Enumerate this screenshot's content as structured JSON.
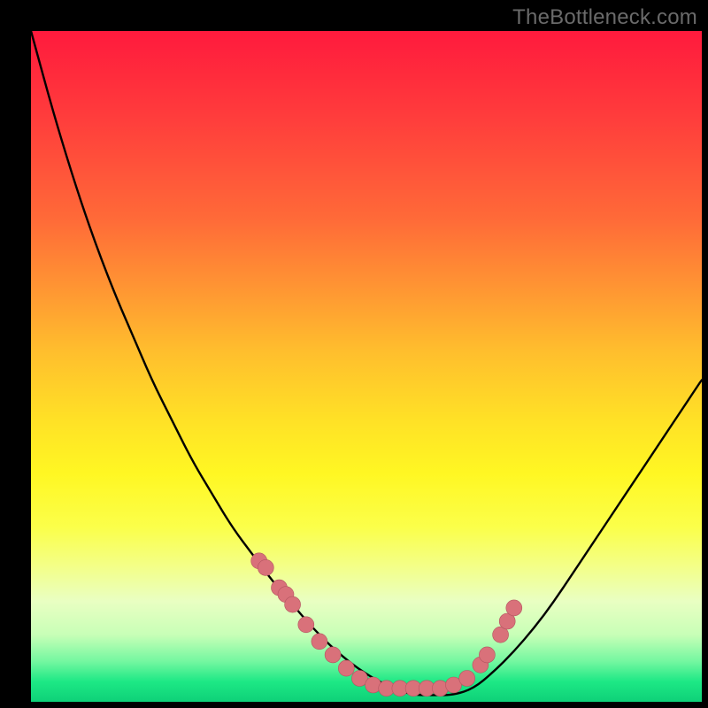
{
  "watermark": "TheBottleneck.com",
  "colors": {
    "dot_fill": "#d9717a",
    "dot_stroke": "#b35560",
    "curve": "#000000"
  },
  "chart_data": {
    "type": "line",
    "title": "",
    "xlabel": "",
    "ylabel": "",
    "xlim": [
      0,
      100
    ],
    "ylim": [
      0,
      100
    ],
    "x": [
      0,
      3,
      6,
      9,
      12,
      15,
      18,
      21,
      24,
      27,
      30,
      33,
      36,
      39,
      42,
      45,
      48,
      51,
      54,
      57,
      60,
      63,
      66,
      69,
      72,
      75,
      78,
      81,
      84,
      87,
      90,
      93,
      96,
      100
    ],
    "values": [
      100,
      89,
      79,
      70,
      62,
      55,
      48,
      42,
      36,
      31,
      26,
      22,
      18,
      14.5,
      11,
      8,
      5.5,
      3.5,
      2,
      1,
      1,
      1,
      2,
      4.5,
      7.5,
      11,
      15,
      19.5,
      24,
      28.5,
      33,
      37.5,
      42,
      48
    ],
    "dots_x": [
      34,
      35,
      37,
      38,
      39,
      41,
      43,
      45,
      47,
      49,
      51,
      53,
      55,
      57,
      59,
      61,
      63,
      65,
      67,
      68,
      70,
      71,
      72
    ],
    "dots_y": [
      21,
      20,
      17,
      16,
      14.5,
      11.5,
      9,
      7,
      5,
      3.5,
      2.5,
      2,
      2,
      2,
      2,
      2,
      2.5,
      3.5,
      5.5,
      7,
      10,
      12,
      14
    ],
    "dot_radius": 9
  }
}
